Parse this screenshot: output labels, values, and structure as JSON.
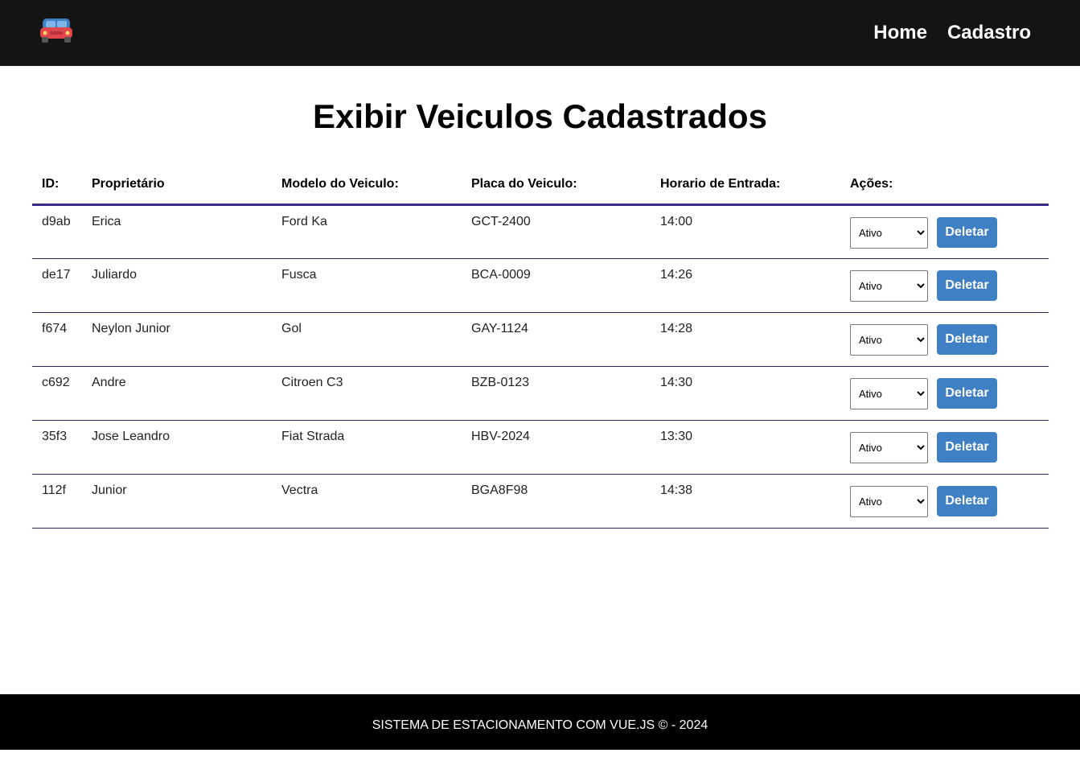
{
  "nav": {
    "logo_icon": "car-icon",
    "links": [
      "Home",
      "Cadastro"
    ]
  },
  "page_title": "Exibir Veiculos Cadastrados",
  "table": {
    "headers": [
      "ID:",
      "Proprietário",
      "Modelo do Veiculo:",
      "Placa do Veiculo:",
      "Horario de Entrada:",
      "Ações:"
    ],
    "rows": [
      {
        "id": "d9ab",
        "owner": "Erica",
        "model": "Ford Ka",
        "plate": "GCT-2400",
        "time": "14:00",
        "status": "Ativo"
      },
      {
        "id": "de17",
        "owner": "Juliardo",
        "model": "Fusca",
        "plate": "BCA-0009",
        "time": "14:26",
        "status": "Ativo"
      },
      {
        "id": "f674",
        "owner": "Neylon Junior",
        "model": "Gol",
        "plate": "GAY-1124",
        "time": "14:28",
        "status": "Ativo"
      },
      {
        "id": "c692",
        "owner": "Andre",
        "model": "Citroen C3",
        "plate": "BZB-0123",
        "time": "14:30",
        "status": "Ativo"
      },
      {
        "id": "35f3",
        "owner": "Jose Leandro",
        "model": "Fiat Strada",
        "plate": "HBV-2024",
        "time": "13:30",
        "status": "Ativo"
      },
      {
        "id": "112f",
        "owner": "Junior",
        "model": "Vectra",
        "plate": "BGA8F98",
        "time": "14:38",
        "status": "Ativo"
      }
    ],
    "delete_label": "Deletar"
  },
  "footer": {
    "text": "SISTEMA DE ESTACIONAMENTO COM VUE.JS © - 2024"
  },
  "colors": {
    "navbar": "#141414",
    "header_rule": "#3a2a8c",
    "delete_button": "#3f7fc4",
    "footer": "#000000"
  }
}
